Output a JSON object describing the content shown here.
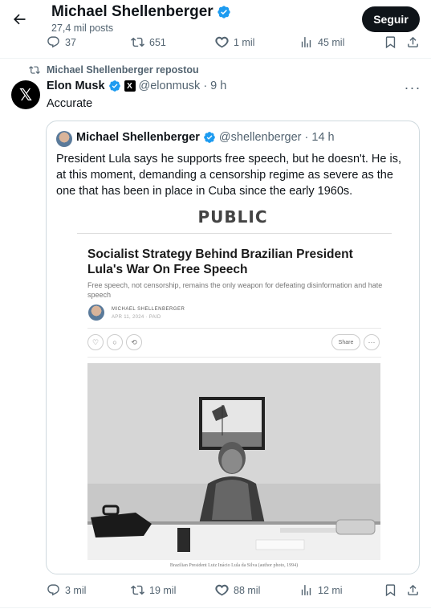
{
  "header": {
    "name": "Michael Shellenberger",
    "posts": "27,4 mil posts",
    "follow_label": "Seguir"
  },
  "top_actions": {
    "replies": "37",
    "reposts": "651",
    "likes": "1 mil",
    "views": "45 mil"
  },
  "repost_label": "Michael Shellenberger repostou",
  "tweet": {
    "author_name": "Elon Musk",
    "author_handle_time": "@elonmusk · 9 h",
    "text": "Accurate",
    "avatar_letter": "𝕏"
  },
  "quote": {
    "author_name": "Michael Shellenberger",
    "author_handle_time": "@shellenberger · 14 h",
    "text": "President Lula says he supports free speech, but he doesn't. He is, at this moment, demanding a censorship regime as severe as the one that has been in place in Cuba since the early 1960s.",
    "article": {
      "publication": "PUBLIC",
      "title": "Socialist Strategy Behind Brazilian President Lula's War On Free Speech",
      "subtitle": "Free speech, not censorship, remains the only weapon for defeating disinformation and hate speech",
      "author": "MICHAEL SHELLENBERGER",
      "date": "APR 11, 2024 · PAID",
      "share_label": "Share",
      "caption": "Brazilian President Luiz Inácio Lula da Silva (author photo, 1994)"
    }
  },
  "bottom_actions": {
    "replies": "3 mil",
    "reposts": "19 mil",
    "likes": "88 mil",
    "views": "12 mi"
  },
  "colors": {
    "verified": "#1d9bf0",
    "secondary_text": "#536471",
    "follow_bg": "#0f1419"
  }
}
